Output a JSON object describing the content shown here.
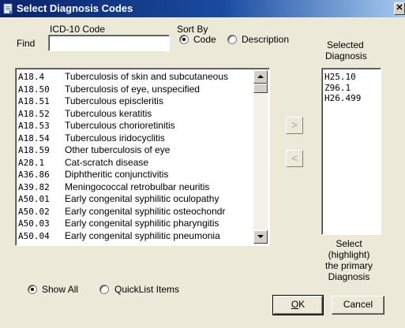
{
  "window": {
    "title": "Select Diagnosis Codes",
    "close_glyph": "✕",
    "icon": "document-icon"
  },
  "filter": {
    "column_label": "ICD-10 Code",
    "find_label": "Find",
    "find_value": "",
    "sort_by_label": "Sort By",
    "sort_code_label": "Code",
    "sort_description_label": "Description",
    "sort_selected": "Code"
  },
  "codes": [
    {
      "code": "A18.4",
      "desc": "Tuberculosis of skin and subcutaneous"
    },
    {
      "code": "A18.50",
      "desc": "Tuberculosis of eye, unspecified"
    },
    {
      "code": "A18.51",
      "desc": "Tuberculous episcleritis"
    },
    {
      "code": "A18.52",
      "desc": "Tuberculous keratitis"
    },
    {
      "code": "A18.53",
      "desc": "Tuberculous chorioretinitis"
    },
    {
      "code": "A18.54",
      "desc": "Tuberculous iridocyclitis"
    },
    {
      "code": "A18.59",
      "desc": "Other tuberculosis of eye"
    },
    {
      "code": "A28.1",
      "desc": "Cat-scratch disease"
    },
    {
      "code": "A36.86",
      "desc": "Diphtheritic conjunctivitis"
    },
    {
      "code": "A39.82",
      "desc": "Meningococcal retrobulbar neuritis"
    },
    {
      "code": "A50.01",
      "desc": "Early congenital syphilitic oculopathy"
    },
    {
      "code": "A50.02",
      "desc": "Early congenital syphilitic osteochondr"
    },
    {
      "code": "A50.03",
      "desc": "Early congenital syphilitic pharyngitis"
    },
    {
      "code": "A50.04",
      "desc": "Early congenital syphilitic pneumonia"
    }
  ],
  "move": {
    "add_glyph": ">",
    "remove_glyph": "<"
  },
  "selected": {
    "label_line1": "Selected",
    "label_line2": "Diagnosis",
    "items": [
      "H25.10",
      "Z96.1",
      "H26.499"
    ]
  },
  "hint": {
    "line1": "Select",
    "line2": "(highlight)",
    "line3": "the primary",
    "line4": "Diagnosis"
  },
  "show": {
    "all_label": "Show All",
    "quicklist_label": "QuickList Items",
    "selected": "Show All"
  },
  "buttons": {
    "ok_accel": "O",
    "ok_rest": "K",
    "cancel_label": "Cancel"
  }
}
